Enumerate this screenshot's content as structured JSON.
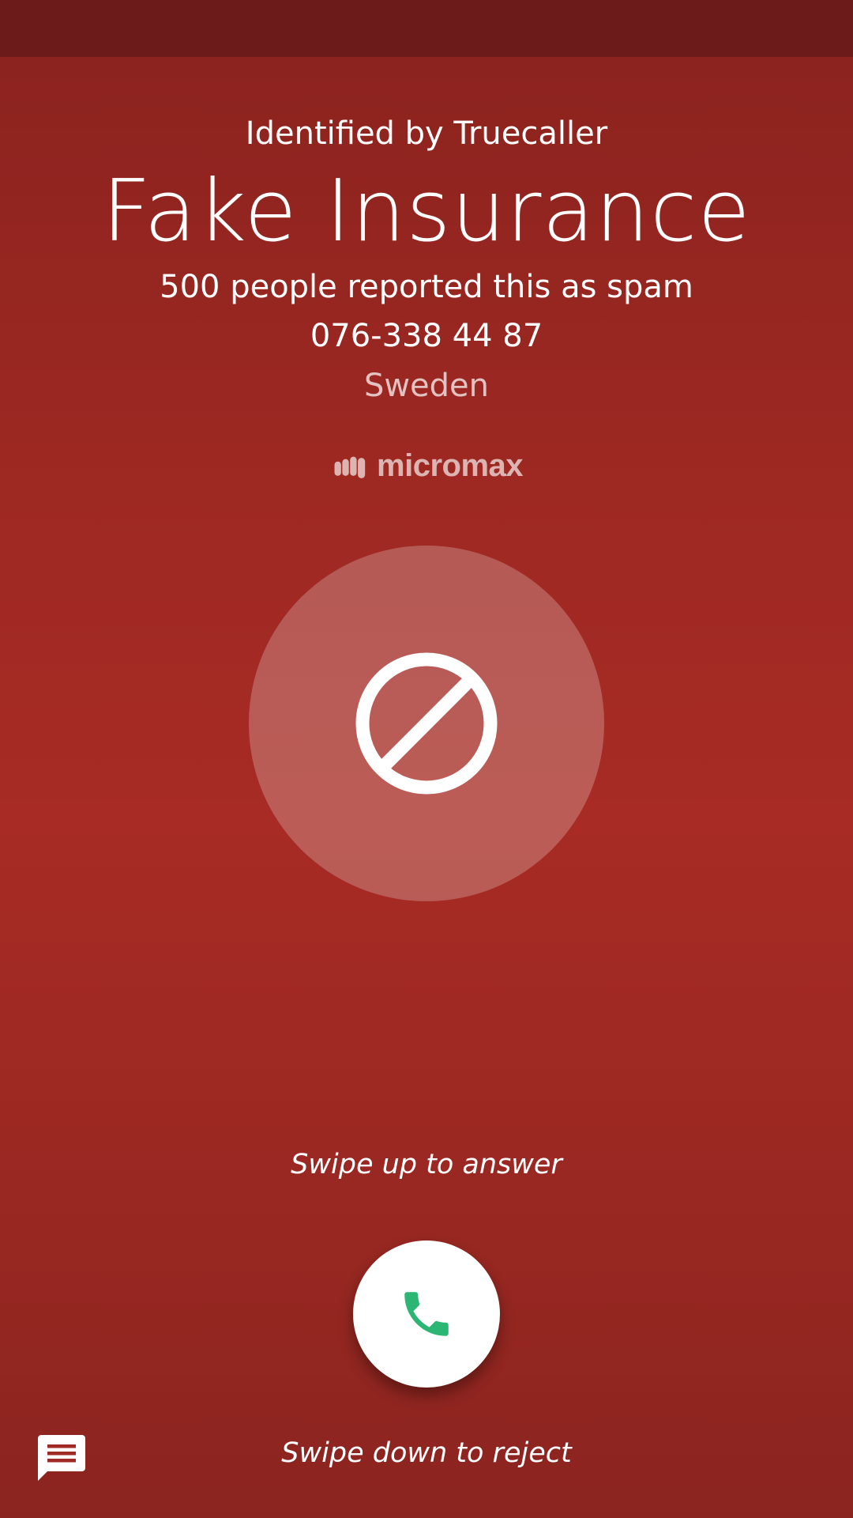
{
  "call": {
    "identified_label": "Identified by Truecaller",
    "caller_name": "Fake Insurance",
    "spam_report": "500 people reported this as spam",
    "phone_number": "076-338 44 87",
    "country": "Sweden",
    "brand_logo_text": "micromax"
  },
  "actions": {
    "swipe_up_hint": "Swipe up to answer",
    "swipe_down_hint": "Swipe down to reject"
  },
  "icons": {
    "block": "block-icon",
    "answer": "phone-icon",
    "message": "message-icon"
  },
  "colors": {
    "background": "#a12a24",
    "status_bar": "#6d1b1a",
    "answer_icon": "#2bb673",
    "text": "#ffffff"
  }
}
